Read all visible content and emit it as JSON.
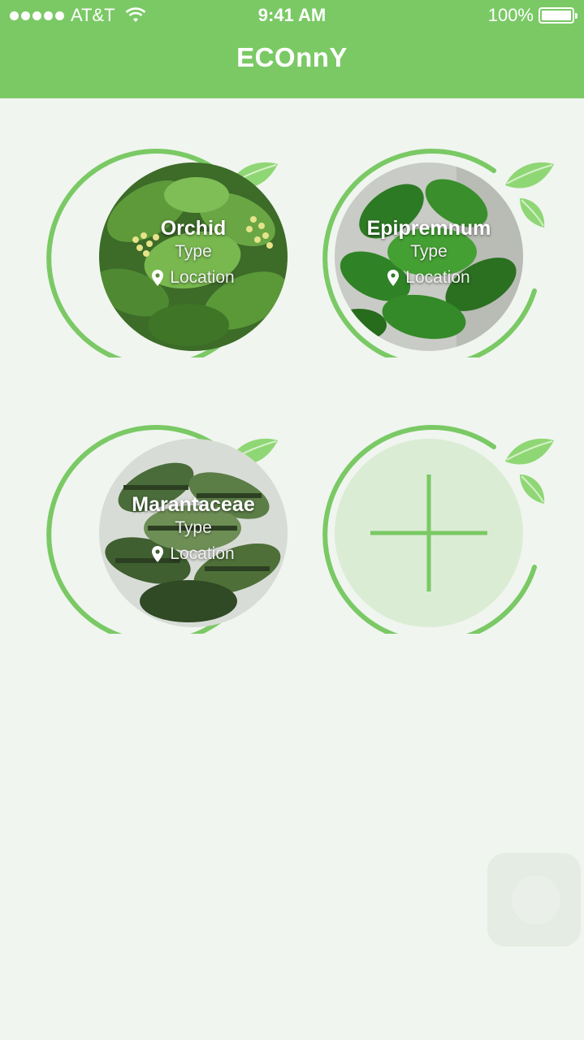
{
  "status_bar": {
    "carrier": "AT&T",
    "time": "9:41 AM",
    "battery": "100%"
  },
  "header": {
    "title": "ECOnnY"
  },
  "plants": [
    {
      "name": "Orchid",
      "type": "Type",
      "location": "Location",
      "photo": "orchid-photo"
    },
    {
      "name": "Epipremnum",
      "type": "Type",
      "location": "Location",
      "photo": "epipremnum-photo"
    },
    {
      "name": "Marantaceae",
      "type": "Type",
      "location": "Location",
      "photo": "marantaceae-photo"
    }
  ],
  "colors": {
    "primary": "#7ac965",
    "background": "#f0f5ef",
    "add_fill": "#dbecd4"
  },
  "icons": {
    "signal": "signal-dots-icon",
    "wifi": "wifi-icon",
    "battery": "battery-icon",
    "location": "location-pin-icon",
    "leaf": "leaf-icon",
    "add": "plus-icon"
  }
}
